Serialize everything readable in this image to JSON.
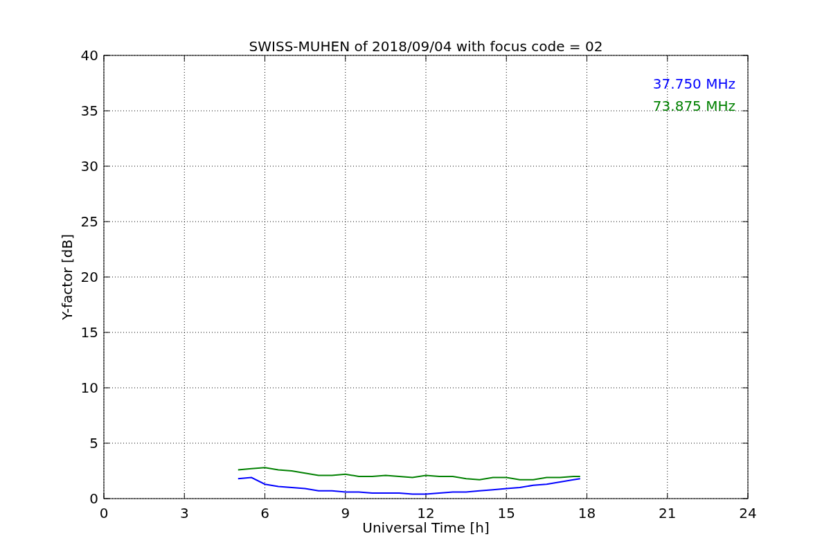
{
  "chart_data": {
    "type": "line",
    "title": "SWISS-MUHEN of 2018/09/04 with focus code = 02",
    "xlabel": "Universal Time [h]",
    "ylabel": "Y-factor [dB]",
    "x": [
      5,
      5.5,
      6,
      6.5,
      7,
      7.5,
      8,
      8.5,
      9,
      9.5,
      10,
      10.5,
      11,
      11.5,
      12,
      12.5,
      13,
      13.5,
      14,
      14.5,
      15,
      15.5,
      16,
      16.5,
      17,
      17.5,
      17.75
    ],
    "series": [
      {
        "name": "37.750 MHz",
        "color": "#0000ff",
        "values": [
          1.8,
          1.9,
          1.3,
          1.1,
          1.0,
          0.9,
          0.7,
          0.7,
          0.6,
          0.6,
          0.5,
          0.5,
          0.5,
          0.4,
          0.4,
          0.5,
          0.6,
          0.6,
          0.7,
          0.8,
          0.9,
          1.0,
          1.2,
          1.3,
          1.5,
          1.7,
          1.8
        ]
      },
      {
        "name": "73.875 MHz",
        "color": "#008000",
        "values": [
          2.6,
          2.7,
          2.8,
          2.6,
          2.5,
          2.3,
          2.1,
          2.1,
          2.2,
          2.0,
          2.0,
          2.1,
          2.0,
          1.9,
          2.1,
          2.0,
          2.0,
          1.8,
          1.7,
          1.9,
          1.9,
          1.7,
          1.7,
          1.9,
          1.9,
          2.0,
          2.0
        ]
      }
    ],
    "grid": true,
    "xlim": [
      0,
      24
    ],
    "ylim": [
      0,
      40
    ],
    "xticks": [
      0,
      3,
      6,
      9,
      12,
      15,
      18,
      21,
      24
    ],
    "yticks": [
      0,
      5,
      10,
      15,
      20,
      25,
      30,
      35,
      40
    ]
  }
}
